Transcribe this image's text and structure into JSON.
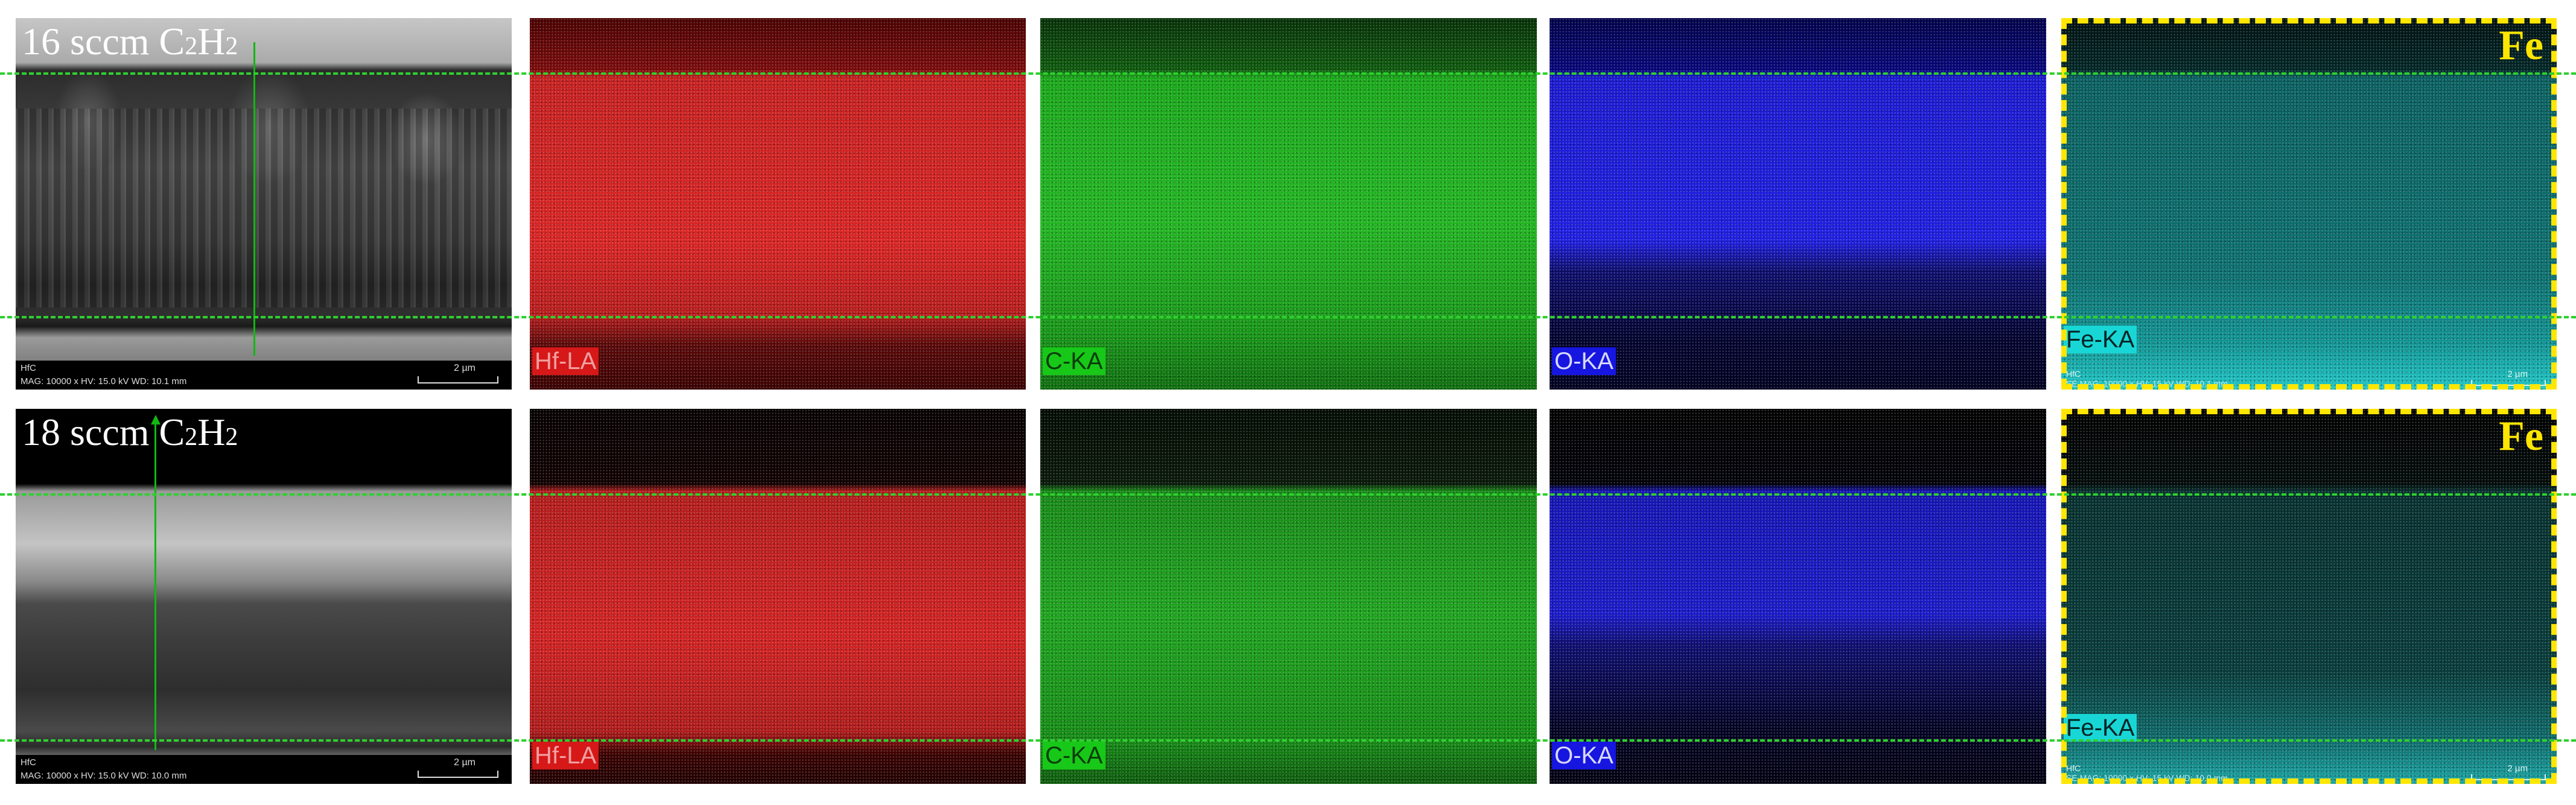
{
  "rows": [
    {
      "sample_label": "16 sccm C2H2",
      "sem_footer": {
        "line1": "HfC",
        "line2": "MAG: 10000 x   HV: 15.0 kV   WD: 10.1 mm",
        "scale": "2 µm"
      },
      "fe_footer": {
        "line1": "HfC",
        "line2": "SE  MAG: 10000 x  HV: 15 kV  WD: 10.1 mm",
        "scale": "2 µm"
      }
    },
    {
      "sample_label": "18 sccm C2H2",
      "sem_footer": {
        "line1": "HfC",
        "line2": "MAG: 10000 x   HV: 15.0 kV   WD: 10.0 mm",
        "scale": "2 µm"
      },
      "fe_footer": {
        "line1": "HfC",
        "line2": "SE  MAG: 10000 x  HV: 15 kV  WD: 10.0 mm",
        "scale": "2 µm"
      }
    }
  ],
  "element_tags": {
    "hf": "Hf-LA",
    "c": "C-KA",
    "o": "O-KA",
    "fe": "Fe-KA"
  },
  "fe_highlight_label": "Fe",
  "colors": {
    "hf": "#d61818",
    "c": "#18c818",
    "o": "#1616e0",
    "fe": "#19d6d6",
    "highlight_frame": "#ffe600",
    "guide_lines": "#2fd02f"
  }
}
